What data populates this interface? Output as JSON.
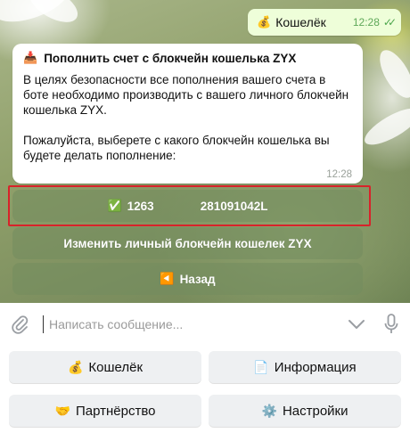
{
  "outgoing": {
    "icon": "money-bag-icon",
    "emoji": "💰",
    "text": "Кошелёк",
    "time": "12:28",
    "status": "✓✓"
  },
  "incoming": {
    "title_icon": "inbox-tray-icon",
    "title_emoji": "📥",
    "title": "Пополнить счет с блокчейн кошелька ZYX",
    "paragraph1": "В целях безопасности все пополнения вашего счета в боте необходимо производить с вашего личного блокчейн кошелька ZYX.",
    "paragraph2": "Пожалуйста, выберете с какого блокчейн кошелька вы будете делать пополнение:",
    "time": "12:28"
  },
  "inline_buttons": {
    "wallet_emoji": "✅",
    "wallet_icon": "check-mark-icon",
    "wallet_part1": "1263",
    "wallet_part2": "281091042L",
    "change_label": "Изменить личный блокчейн кошелек ZYX",
    "back_emoji": "◀️",
    "back_icon": "back-arrow-icon",
    "back_label": "Назад"
  },
  "input": {
    "placeholder": "Написать сообщение..."
  },
  "keyboard": {
    "wallet": {
      "emoji": "💰",
      "label": "Кошелёк"
    },
    "info": {
      "emoji": "📄",
      "label": "Информация"
    },
    "partners": {
      "emoji": "🤝",
      "label": "Партнёрство"
    },
    "settings": {
      "emoji": "⚙️",
      "label": "Настройки"
    }
  },
  "colors": {
    "highlight": "#d8232a",
    "outgoing_bubble": "#eefed9",
    "inline_button": "#738c5f"
  }
}
